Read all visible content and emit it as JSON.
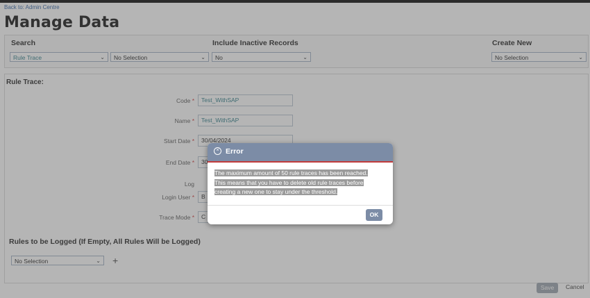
{
  "back_link": "Back to: Admin Centre",
  "page_title": "Manage Data",
  "search": {
    "label": "Search",
    "type_value": "Rule Trace",
    "item_value": "No Selection"
  },
  "inactive": {
    "label": "Include Inactive Records",
    "value": "No"
  },
  "create_new": {
    "label": "Create New",
    "value": "No Selection"
  },
  "section_title": "Rule Trace:",
  "form": {
    "code_label": "Code",
    "code_value": "Test_WithSAP",
    "name_label": "Name",
    "name_value": "Test_WithSAP",
    "start_label": "Start Date",
    "start_value": "30/04/2024",
    "end_label": "End Date",
    "end_value": "30",
    "log_label": "Log",
    "login_label": "Login User",
    "login_value": "B",
    "trace_label": "Trace Mode",
    "trace_value": "C"
  },
  "rules": {
    "title": "Rules to be Logged (If Empty, All Rules Will be Logged)",
    "value": "No Selection"
  },
  "footer": {
    "save": "Save",
    "cancel": "Cancel"
  },
  "dialog": {
    "title": "Error",
    "line1": "The maximum amount of 50 rule traces has been reached.",
    "line2": "This means that you have to delete old rule traces before",
    "line3": "creating a new one to stay under the threshold.",
    "ok": "OK"
  }
}
